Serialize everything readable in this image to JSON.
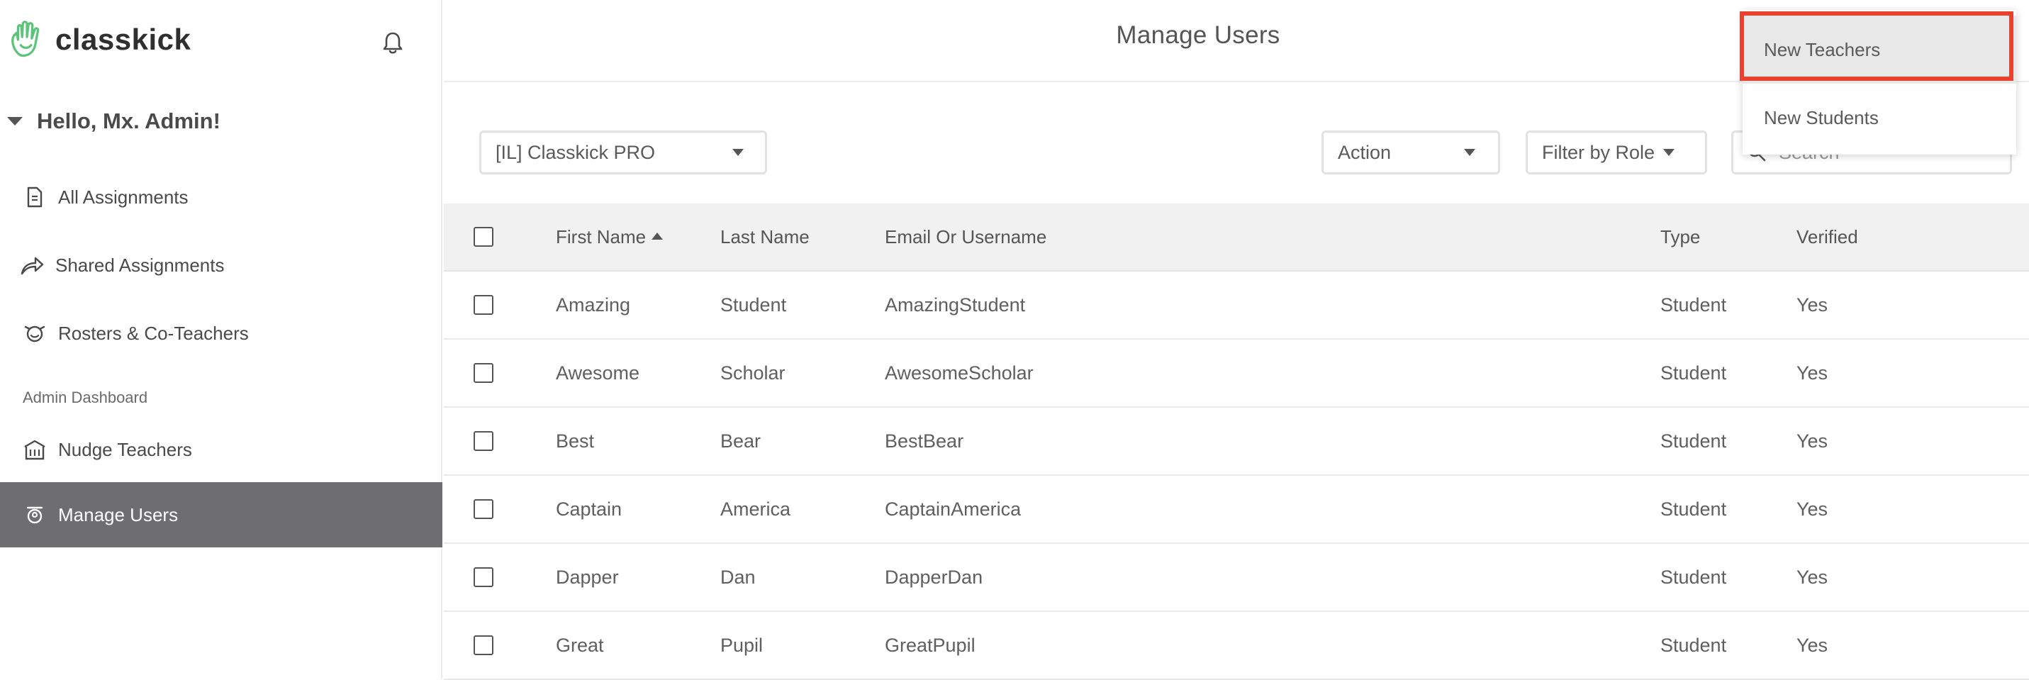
{
  "app": {
    "brand": "classkick",
    "logo_icon": "waving-hand-icon",
    "bell_icon": "bell-icon"
  },
  "sidebar": {
    "greeting": "Hello, Mx. Admin!",
    "items": [
      {
        "label": "All Assignments",
        "icon": "document-icon"
      },
      {
        "label": "Shared Assignments",
        "icon": "share-arrow-icon"
      },
      {
        "label": "Rosters & Co-Teachers",
        "icon": "face-icon"
      }
    ],
    "section_label": "Admin Dashboard",
    "admin_items": [
      {
        "label": "Nudge Teachers",
        "icon": "school-building-icon"
      },
      {
        "label": "Manage Users",
        "icon": "person-badge-icon",
        "active": true
      }
    ]
  },
  "header": {
    "title": "Manage Users"
  },
  "toolbar": {
    "school_select": "[IL] Classkick PRO",
    "action_select": "Action",
    "role_filter": "Filter by Role",
    "search_placeholder": "Search"
  },
  "table": {
    "columns": [
      "First Name",
      "Last Name",
      "Email Or Username",
      "Type",
      "Verified"
    ],
    "sorted_column": "First Name",
    "rows": [
      {
        "first": "Amazing",
        "last": "Student",
        "email": "AmazingStudent",
        "type": "Student",
        "verified": "Yes"
      },
      {
        "first": "Awesome",
        "last": "Scholar",
        "email": "AwesomeScholar",
        "type": "Student",
        "verified": "Yes"
      },
      {
        "first": "Best",
        "last": "Bear",
        "email": "BestBear",
        "type": "Student",
        "verified": "Yes"
      },
      {
        "first": "Captain",
        "last": "America",
        "email": "CaptainAmerica",
        "type": "Student",
        "verified": "Yes"
      },
      {
        "first": "Dapper",
        "last": "Dan",
        "email": "DapperDan",
        "type": "Student",
        "verified": "Yes"
      },
      {
        "first": "Great",
        "last": "Pupil",
        "email": "GreatPupil",
        "type": "Student",
        "verified": "Yes"
      }
    ]
  },
  "dropdown_menu": {
    "items": [
      "New Teachers",
      "New Students"
    ],
    "highlighted_item": "New Teachers"
  },
  "colors": {
    "brand_green": "#5cc47a",
    "active_nav_bg": "#6e6e70",
    "header_row_bg": "#f1f1f1",
    "highlight_border": "#e8412d"
  }
}
